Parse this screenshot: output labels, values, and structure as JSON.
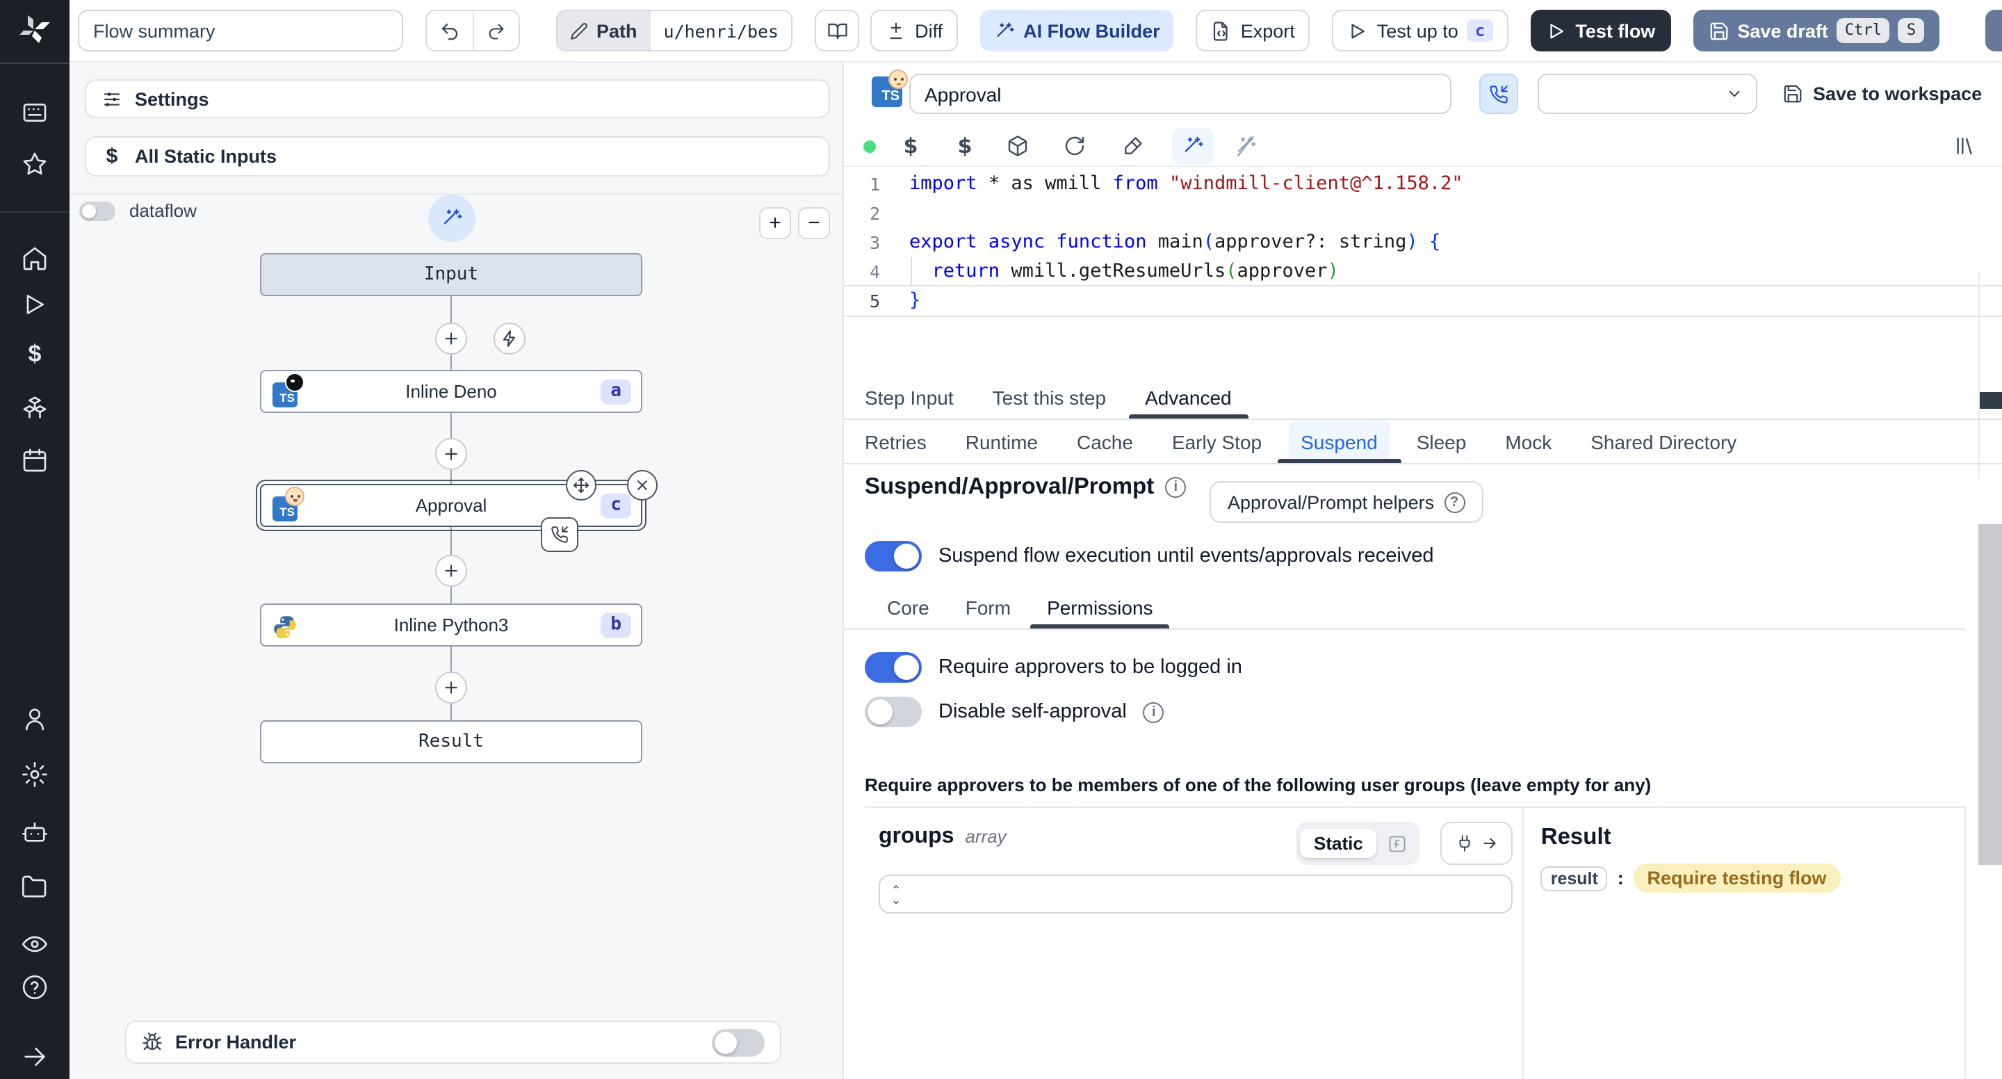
{
  "topbar": {
    "flow_summary": "Flow summary",
    "path_label": "Path",
    "path_value": "u/henri/bes",
    "diff_label": "Diff",
    "ai_flow_builder_label": "AI Flow Builder",
    "export_label": "Export",
    "test_up_to_label": "Test up to",
    "test_up_to_badge": "c",
    "test_flow_label": "Test flow",
    "save_draft_label": "Save draft",
    "save_draft_key1": "Ctrl",
    "save_draft_key2": "S"
  },
  "sidebar": {
    "icons": [
      "windmill-logo",
      "workspace-icon",
      "star-icon",
      "home-icon",
      "runs-icon",
      "variables-icon",
      "resources-icon",
      "schedules-icon",
      "users-icon",
      "settings-icon",
      "workers-icon",
      "folders-icon",
      "audit-icon",
      "help-icon",
      "expand-icon"
    ]
  },
  "flow": {
    "settings_label": "Settings",
    "static_inputs_label": "All Static Inputs",
    "dataflow_label": "dataflow",
    "input_node": "Input",
    "deno_label": "Inline Deno",
    "deno_badge": "a",
    "approval_label": "Approval",
    "approval_badge": "c",
    "python_label": "Inline Python3",
    "python_badge": "b",
    "result_node": "Result",
    "error_handler_label": "Error Handler"
  },
  "step_editor": {
    "title": "Approval",
    "save_to_workspace": "Save to workspace"
  },
  "code": {
    "lines": [
      [
        [
          "kw",
          "import"
        ],
        [
          "pl",
          " * as wmill "
        ],
        [
          "kw",
          "from"
        ],
        [
          "pl",
          " "
        ],
        [
          "str",
          "\"windmill-client@^1.158.2\""
        ]
      ],
      [
        [
          "pl",
          ""
        ]
      ],
      [
        [
          "kw",
          "export"
        ],
        [
          "pl",
          " "
        ],
        [
          "kw",
          "async"
        ],
        [
          "pl",
          " "
        ],
        [
          "kw",
          "function"
        ],
        [
          "pl",
          " main"
        ],
        [
          "b1",
          "("
        ],
        [
          "pl",
          "approver?: string"
        ],
        [
          "b1",
          ")"
        ],
        [
          "pl",
          " "
        ],
        [
          "b1",
          "{"
        ]
      ],
      [
        [
          "pl",
          "  "
        ],
        [
          "kw",
          "return"
        ],
        [
          "pl",
          " wmill.getResumeUrls"
        ],
        [
          "b2",
          "("
        ],
        [
          "pl",
          "approver"
        ],
        [
          "b2",
          ")"
        ]
      ],
      [
        [
          "b1",
          "}"
        ]
      ]
    ]
  },
  "tabs": {
    "step": [
      "Step Input",
      "Test this step",
      "Advanced"
    ],
    "advanced": [
      "Retries",
      "Runtime",
      "Cache",
      "Early Stop",
      "Suspend",
      "Sleep",
      "Mock",
      "Shared Directory"
    ]
  },
  "suspend": {
    "heading": "Suspend/Approval/Prompt",
    "helpers_label": "Approval/Prompt helpers",
    "suspend_toggle_label": "Suspend flow execution until events/approvals received",
    "sub_tabs": [
      "Core",
      "Form",
      "Permissions"
    ],
    "logged_in_label": "Require approvers to be logged in",
    "self_approval_label": "Disable self-approval",
    "groups_note": "Require approvers to be members of one of the following user groups (leave empty for any)",
    "groups_name": "groups",
    "groups_type": "array",
    "static_label": "Static",
    "result_heading": "Result",
    "result_key": "result",
    "result_value": "Require testing flow"
  },
  "colors": {
    "toggle_on": "#3b6ce4",
    "dark_button": "#272e3b",
    "save_draft_button": "#64799c",
    "ai_builder_bg": "#dbeafe",
    "node_badge_bg": "#dde3fb",
    "node_badge_text": "#3730a3",
    "suspend_tab_text": "#2563eb",
    "result_chip_bg": "#faf0bd",
    "result_chip_text": "#9a6a1f",
    "status_dot": "#4ade80"
  }
}
